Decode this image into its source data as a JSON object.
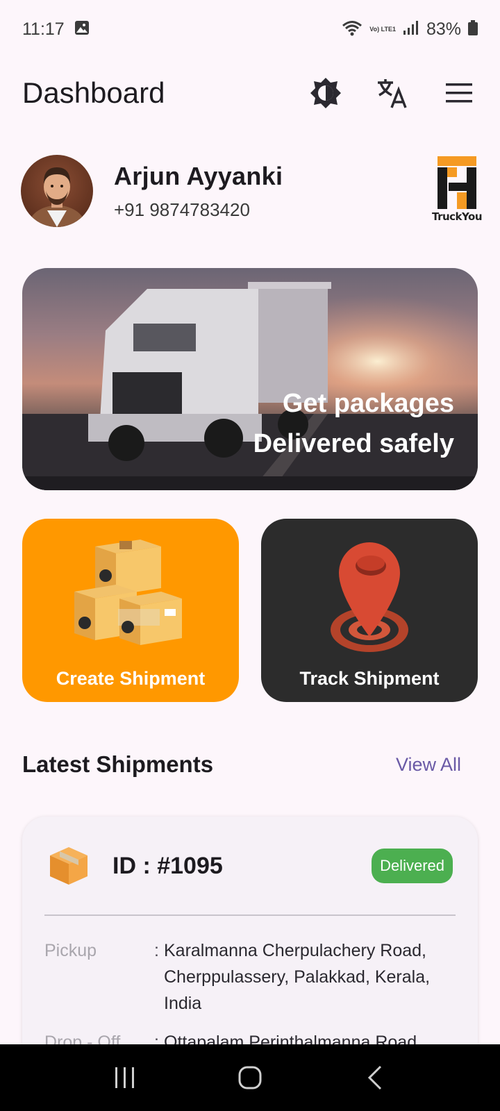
{
  "status_bar": {
    "time": "11:17",
    "network_label": "Vo) LTE1",
    "battery_percent": "83%"
  },
  "app_bar": {
    "title": "Dashboard",
    "icons": [
      "brightness-icon",
      "translate-icon",
      "menu-icon"
    ]
  },
  "profile": {
    "name": "Arjun Ayyanki",
    "phone": "+91 9874783420",
    "brand": "TruckYou"
  },
  "hero": {
    "line1": "Get packages",
    "line2": "Delivered safely"
  },
  "actions": {
    "create_label": "Create Shipment",
    "track_label": "Track Shipment",
    "colors": {
      "create": "#ff9800",
      "track": "#2c2c2c"
    }
  },
  "latest": {
    "title": "Latest Shipments",
    "view_all": "View All",
    "shipment": {
      "id": "ID : #1095",
      "status": "Delivered",
      "status_color": "#4caf50",
      "pickup_label": "Pickup",
      "pickup_value": "Karalmanna Cherpulachery Road, Cherppulassery, Palakkad, Kerala, India",
      "dropoff_label": "Drop - Off",
      "dropoff_value": "Ottapalam Perinthalmanna Road,"
    }
  },
  "nav": {
    "icons": [
      "recents-icon",
      "home-icon",
      "back-icon"
    ]
  }
}
